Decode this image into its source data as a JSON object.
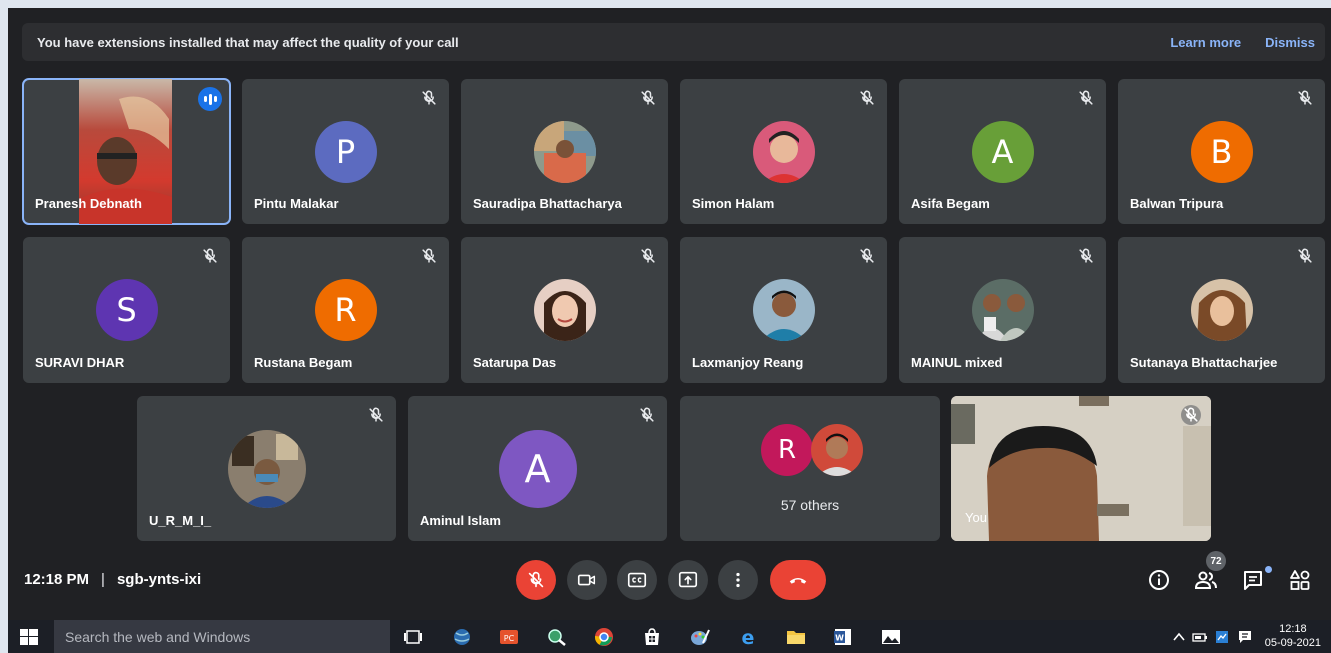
{
  "banner": {
    "message": "You have extensions installed that may affect the quality of your call",
    "learn_more": "Learn more",
    "dismiss": "Dismiss"
  },
  "participants": [
    {
      "name": "Pranesh Debnath",
      "type": "video",
      "speaking": true
    },
    {
      "name": "Pintu Malakar",
      "initial": "P",
      "color": "#5c6bc0"
    },
    {
      "name": "Sauradipa Bhattacharya",
      "type": "photo"
    },
    {
      "name": "Simon Halam",
      "type": "photo"
    },
    {
      "name": "Asifa Begam",
      "initial": "A",
      "color": "#689f38"
    },
    {
      "name": "Balwan Tripura",
      "initial": "B",
      "color": "#ef6c00"
    },
    {
      "name": "SURAVI DHAR",
      "initial": "S",
      "color": "#5e35b1"
    },
    {
      "name": "Rustana Begam",
      "initial": "R",
      "color": "#ef6c00"
    },
    {
      "name": "Satarupa Das",
      "type": "photo"
    },
    {
      "name": "Laxmanjoy Reang",
      "type": "photo"
    },
    {
      "name": "MAINUL mixed",
      "type": "photo"
    },
    {
      "name": "Sutanaya Bhattacharjee",
      "type": "photo"
    },
    {
      "name": "U_R_M_I_",
      "type": "photo"
    },
    {
      "name": "Aminul Islam",
      "initial": "A",
      "color": "#7e57c2"
    }
  ],
  "others": {
    "label": "57 others",
    "initial": "R",
    "color": "#c2185b"
  },
  "self": {
    "name": "You"
  },
  "meeting": {
    "time": "12:18 PM",
    "separator": "|",
    "code": "sgb-ynts-ixi"
  },
  "people_count": "72",
  "taskbar": {
    "search_placeholder": "Search the web and Windows",
    "time": "12:18",
    "date": "05-09-2021"
  }
}
